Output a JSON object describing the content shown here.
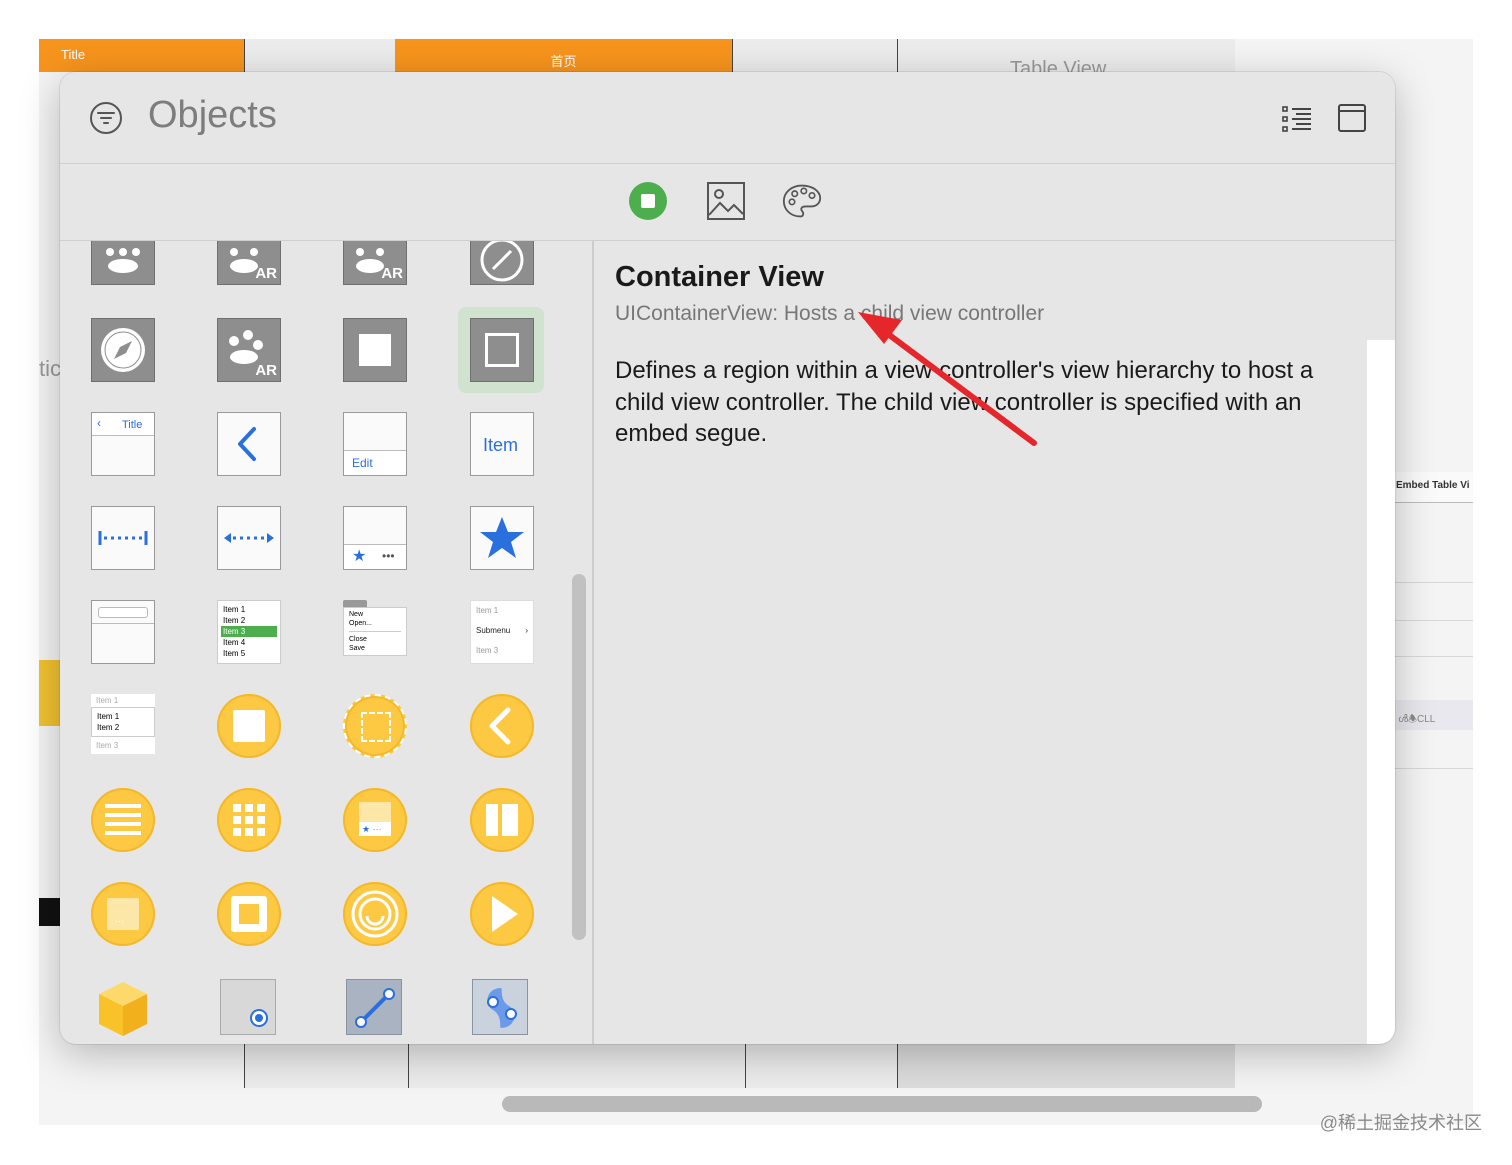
{
  "background": {
    "title_tab": "Title",
    "home_tab": "首页",
    "table_view_tab": "Table View",
    "side_fragment": "tic",
    "embed_label": "Embed Table Vi",
    "cell_label": "ൾ🕭CLL",
    "watermark": "@稀土掘金技术社区"
  },
  "panel": {
    "title": "Objects",
    "segments": [
      {
        "icon": "objects-square-icon",
        "selected": true
      },
      {
        "icon": "image-icon",
        "selected": false
      },
      {
        "icon": "palette-icon",
        "selected": false
      }
    ]
  },
  "library": {
    "navigation_title": "Title",
    "toolbar_edit": "Edit",
    "bar_item": "Item",
    "list_items": [
      "Item 1",
      "Item 2",
      "Item 3",
      "Item 4",
      "Item 5"
    ],
    "menu_items": [
      "New",
      "Open...",
      "Close",
      "Save"
    ],
    "submenu_items": [
      "Item 1",
      "Submenu",
      "Item 3"
    ],
    "popup_items": [
      "Item 1",
      "Item 1",
      "Item 2",
      "Item 3"
    ],
    "ar_badge": "AR"
  },
  "detail": {
    "title": "Container View",
    "subtitle": "UIContainerView: Hosts a child view controller",
    "description": "Defines a region within a view controller's view hierarchy to host a child view controller. The child view controller is specified with an embed segue."
  },
  "colors": {
    "accent_orange": "#f7941d",
    "selected_green": "#4cae4c",
    "icon_yellow": "#fdc842",
    "icon_blue": "#2a6fde",
    "annotation_red": "#e5262a"
  }
}
